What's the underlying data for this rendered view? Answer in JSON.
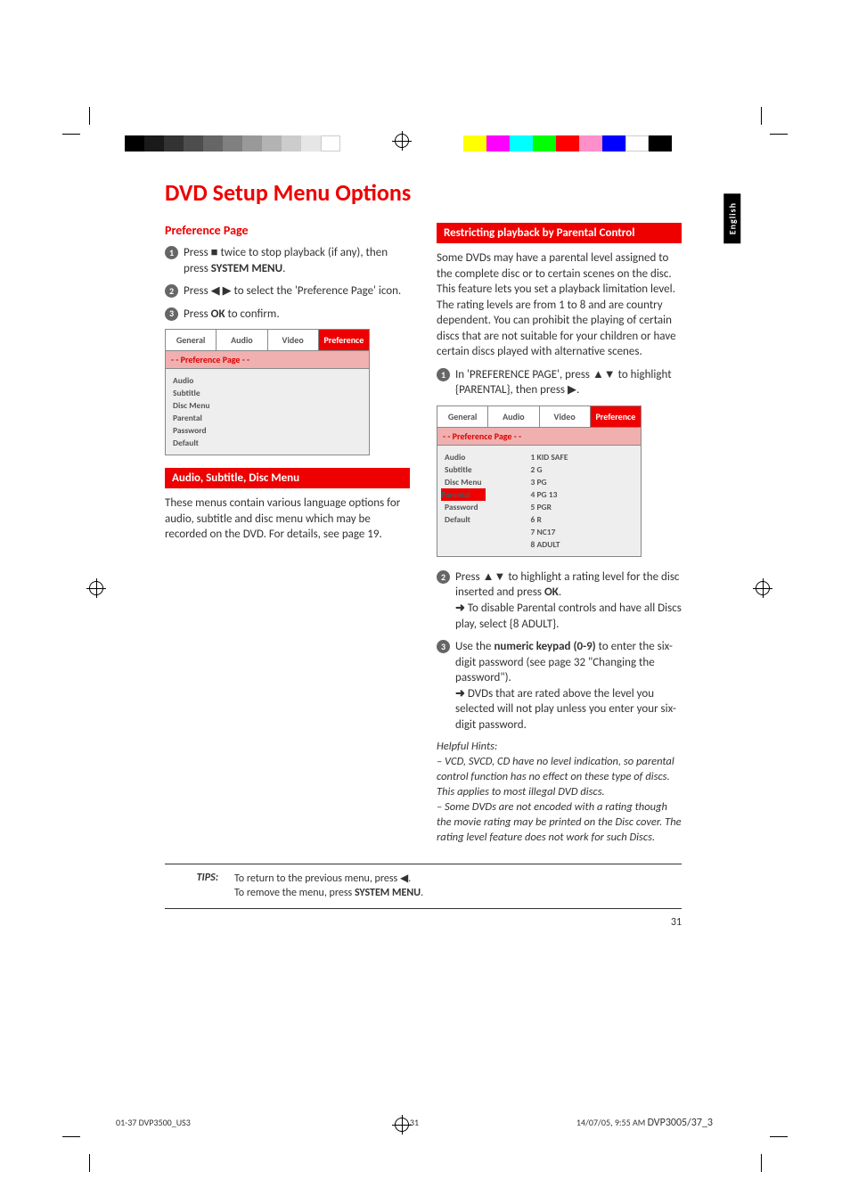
{
  "page_title": "DVD Setup Menu Options",
  "language_tab": "English",
  "left": {
    "heading": "Preference Page",
    "step1a": "Press ",
    "step1b": " twice to stop playback (if any), then press ",
    "step1c": "SYSTEM MENU",
    "step1d": ".",
    "step2a": "Press ",
    "step2b": " to select the 'Preference Page' icon.",
    "step3a": "Press ",
    "step3b": "OK",
    "step3c": " to confirm.",
    "ui": {
      "tabs": [
        "General",
        "Audio",
        "Video",
        "Preference"
      ],
      "subtitle": "- -   Preference Page   - -",
      "items": [
        "Audio",
        "Subtitle",
        "Disc Menu",
        "Parental",
        "Password",
        "Default"
      ]
    },
    "sub_heading": "Audio, Subtitle, Disc Menu",
    "sub_para": "These menus contain various language options for audio, subtitle and disc menu which may be recorded on the DVD.  For details, see page 19."
  },
  "right": {
    "heading": "Restricting playback by Parental Control",
    "intro": "Some DVDs may have a parental level assigned to the complete disc or to certain scenes on the disc.  This feature lets you set a playback limitation level. The rating levels are from 1 to 8 and are country dependent.  You can prohibit the playing of certain discs that are not suitable for your children or have certain discs played with alternative scenes.",
    "step1a": "In 'PREFERENCE PAGE', press ",
    "step1b": " to highlight {PARENTAL}, then press ",
    "step1c": ".",
    "ui": {
      "tabs": [
        "General",
        "Audio",
        "Video",
        "Preference"
      ],
      "subtitle": "- -   Preference Page   - -",
      "col1": [
        "Audio",
        "Subtitle",
        "Disc Menu",
        "Parental",
        "Password",
        "Default"
      ],
      "selected_left": "Parental",
      "col2": [
        "1 KID SAFE",
        "2 G",
        "3 PG",
        "4 PG 13",
        "5 PGR",
        "6 R",
        "7 NC17",
        "8 ADULT"
      ],
      "selected_right": "1 KID SAFE"
    },
    "step2a": "Press ",
    "step2b": " to highlight a rating level for the disc inserted and press ",
    "step2c": "OK",
    "step2d": ".",
    "step2_sub": "To disable Parental controls and have all Discs play, select {8 ADULT}.",
    "step3a": "Use the ",
    "step3b": "numeric keypad (0-9)",
    "step3c": " to enter the six-digit password (see page 32 \"Changing the password\").",
    "step3_sub": "DVDs that are rated above the level you selected will not play unless you enter your six-digit password.",
    "hints_title": "Helpful Hints:",
    "hint1": "–    VCD, SVCD, CD have no level indication, so parental control function has no effect on these type of discs. This applies to most illegal DVD discs.",
    "hint2": "–    Some DVDs are not encoded with a rating though the movie rating may be printed on the Disc cover.  The rating level feature does not work for such Discs."
  },
  "tips": {
    "label": "TIPS:",
    "line1a": "To return to the previous menu, press ",
    "line1b": ".",
    "line2a": "To remove the menu, press ",
    "line2b": "SYSTEM MENU",
    "line2c": "."
  },
  "page_number": "31",
  "footer": {
    "left": "01-37 DVP3500_US3",
    "mid": "31",
    "right_a": "14/07/05, 9:55 AM",
    "right_b": "DVP3005/37_3"
  }
}
